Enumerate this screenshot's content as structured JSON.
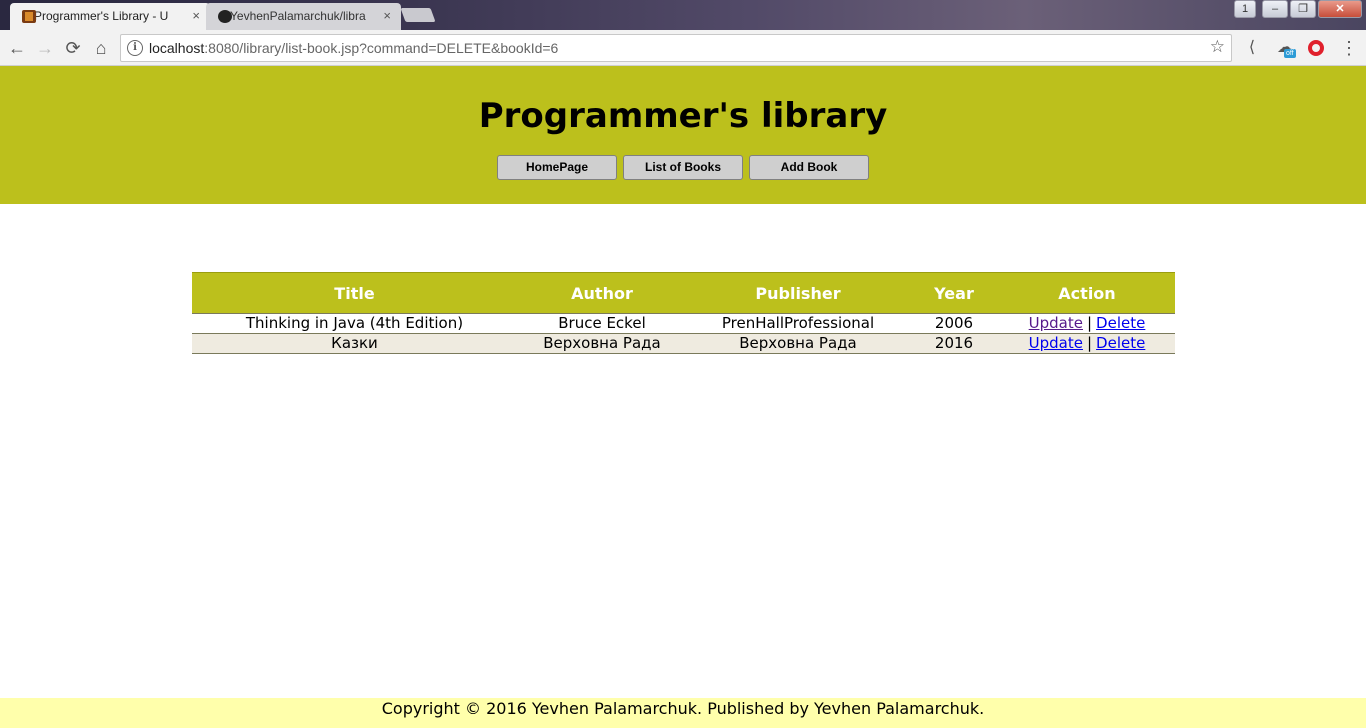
{
  "browser": {
    "tabs": [
      {
        "title": "Programmer's Library - U",
        "close": "×",
        "active": true
      },
      {
        "title": "YevhenPalamarchuk/libra",
        "close": "×",
        "active": false
      }
    ],
    "window_buttons": {
      "user": "1",
      "minimize": "–",
      "maximize": "❐",
      "close": "✕"
    },
    "nav": {
      "back": "←",
      "forward": "→",
      "reload": "⟳",
      "home": "⌂"
    },
    "address": {
      "info_icon": "i",
      "host": "localhost",
      "rest": ":8080/library/list-book.jsp?command=DELETE&bookId=6",
      "star": "☆"
    },
    "extensions": {
      "ext1": "⟨",
      "ext2_badge": "off",
      "ext3": "",
      "menu": "⋮"
    }
  },
  "header": {
    "title": "Programmer's library",
    "nav_buttons": [
      "HomePage",
      "List of Books",
      "Add Book"
    ]
  },
  "table": {
    "headers": [
      "Title",
      "Author",
      "Publisher",
      "Year",
      "Action"
    ],
    "rows": [
      {
        "title": "Thinking in Java (4th Edition)",
        "author": "Bruce Eckel",
        "publisher": "PrenHallProfessional",
        "year": "2006",
        "update": "Update",
        "delete": "Delete"
      },
      {
        "title": "Казки",
        "author": "Верховна Рада",
        "publisher": "Верховна Рада",
        "year": "2016",
        "update": "Update",
        "delete": "Delete"
      }
    ],
    "separator": "|"
  },
  "footer": {
    "text": "Copyright © 2016 Yevhen Palamarchuk. Published by Yevhen Palamarchuk."
  },
  "colors": {
    "header_bg": "#bcc01c",
    "footer_bg": "#ffffab",
    "alt_row_bg": "#efebe0"
  }
}
